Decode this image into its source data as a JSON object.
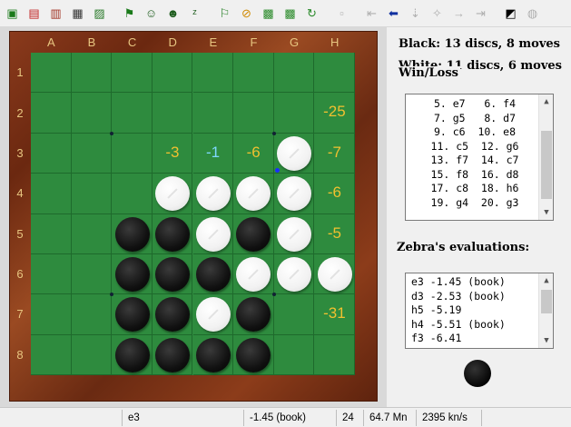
{
  "toolbar": {
    "buttons": [
      {
        "icon": "new-game-icon"
      },
      {
        "icon": "open-icon"
      },
      {
        "icon": "books-icon"
      },
      {
        "icon": "save-icon"
      },
      {
        "icon": "folder-icon"
      },
      {
        "icon": "flag-icon"
      },
      {
        "icon": "person-icon"
      },
      {
        "icon": "person-gear-icon"
      },
      {
        "icon": "sleep-icon"
      },
      {
        "icon": "arrow-down-flag-icon"
      },
      {
        "icon": "stop-icon"
      },
      {
        "icon": "board-green-icon"
      },
      {
        "icon": "board-green-2-icon"
      },
      {
        "icon": "refresh-icon"
      },
      {
        "icon": "blank-icon"
      },
      {
        "icon": "first-move-icon"
      },
      {
        "icon": "back-icon"
      },
      {
        "icon": "down-icon"
      },
      {
        "icon": "hint-icon"
      },
      {
        "icon": "forward-icon"
      },
      {
        "icon": "last-move-icon"
      },
      {
        "icon": "flip-board-icon"
      },
      {
        "icon": "globe-icon"
      }
    ]
  },
  "board": {
    "columns": [
      "A",
      "B",
      "C",
      "D",
      "E",
      "F",
      "G",
      "H"
    ],
    "rows": [
      "1",
      "2",
      "3",
      "4",
      "5",
      "6",
      "7",
      "8"
    ],
    "discs": [
      {
        "cell": "G3",
        "color": "white"
      },
      {
        "cell": "D4",
        "color": "white"
      },
      {
        "cell": "E4",
        "color": "white"
      },
      {
        "cell": "F4",
        "color": "white"
      },
      {
        "cell": "G4",
        "color": "white"
      },
      {
        "cell": "C5",
        "color": "black"
      },
      {
        "cell": "D5",
        "color": "black"
      },
      {
        "cell": "E5",
        "color": "white"
      },
      {
        "cell": "F5",
        "color": "black"
      },
      {
        "cell": "G5",
        "color": "white"
      },
      {
        "cell": "C6",
        "color": "black"
      },
      {
        "cell": "D6",
        "color": "black"
      },
      {
        "cell": "E6",
        "color": "black"
      },
      {
        "cell": "F6",
        "color": "white"
      },
      {
        "cell": "G6",
        "color": "white"
      },
      {
        "cell": "H6",
        "color": "white"
      },
      {
        "cell": "C7",
        "color": "black"
      },
      {
        "cell": "D7",
        "color": "black"
      },
      {
        "cell": "E7",
        "color": "white"
      },
      {
        "cell": "F7",
        "color": "black"
      },
      {
        "cell": "C8",
        "color": "black"
      },
      {
        "cell": "D8",
        "color": "black"
      },
      {
        "cell": "E8",
        "color": "black"
      },
      {
        "cell": "F8",
        "color": "black"
      }
    ],
    "evaluations": [
      {
        "cell": "H2",
        "text": "-25",
        "color": "#f0c030"
      },
      {
        "cell": "D3",
        "text": "-3",
        "color": "#f0c030"
      },
      {
        "cell": "E3",
        "text": "-1",
        "color": "#7fd8ff"
      },
      {
        "cell": "F3",
        "text": "-6",
        "color": "#f0c030"
      },
      {
        "cell": "H3",
        "text": "-7",
        "color": "#f0c030"
      },
      {
        "cell": "H4",
        "text": "-6",
        "color": "#f0c030"
      },
      {
        "cell": "H5",
        "text": "-5",
        "color": "#f0c030"
      },
      {
        "cell": "H7",
        "text": "-31",
        "color": "#f0c030"
      }
    ],
    "last_move_marker": {
      "cell": "G3",
      "color": "#1a2cff"
    }
  },
  "side": {
    "black_score": "Black:   13 discs, 8 moves",
    "white_score": "White:  11 discs, 6 moves",
    "win_loss_label": "Win/Loss",
    "moves": [
      "5. e7   6. f4",
      "7. g5   8. d7",
      "9. c6  10. e8",
      "11. c5  12. g6",
      "13. f7  14. c7",
      "15. f8  16. d8",
      "17. c8  18. h6",
      "19. g4  20. g3"
    ],
    "zebra_title": "Zebra's evaluations:",
    "evaluations": [
      "e3 -1.45 (book)",
      "d3 -2.53 (book)",
      "h5 -5.19",
      "h4 -5.51 (book)",
      "f3 -6.41"
    ]
  },
  "status": {
    "move": "e3",
    "score": "-1.45 (book)",
    "depth": "24",
    "nodes": "64.7 Mn",
    "speed": "2395 kn/s"
  }
}
